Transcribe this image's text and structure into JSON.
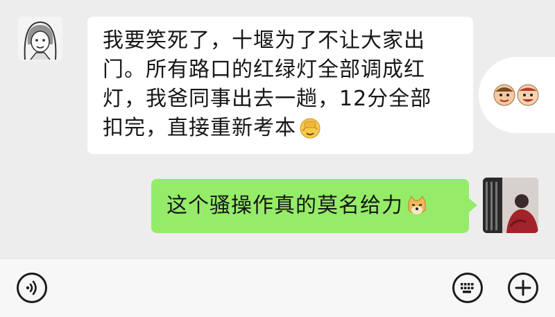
{
  "chat": {
    "incoming": {
      "lines": [
        "我要笑死了，十堰为了不让大家出",
        "门。所有路口的红绿灯全部调成红",
        "灯，我爸同事出去一趟，12分全部",
        "扣完，直接重新考本"
      ],
      "emoji": "facepalm-emoji"
    },
    "outgoing": {
      "text": "这个骚操作真的莫名给力",
      "emoji": "doge-emoji"
    }
  },
  "colors": {
    "background": "#ededed",
    "incoming_bubble": "#ffffff",
    "outgoing_bubble": "#95ec69",
    "text": "#161616"
  },
  "bottom_bar": {
    "icons": [
      "voice-icon",
      "keyboard-icon",
      "plus-icon"
    ]
  }
}
